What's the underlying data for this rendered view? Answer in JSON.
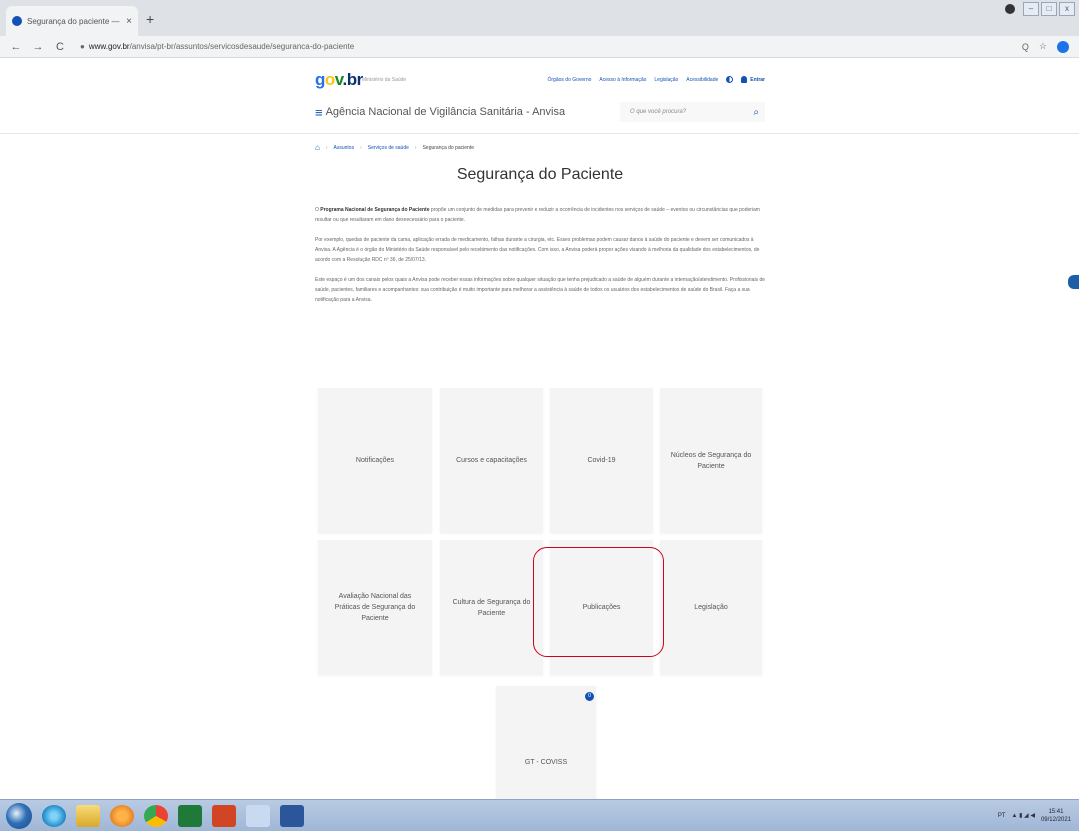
{
  "browser": {
    "tab_title": "Segurança do paciente — Portal",
    "tab_close": "×",
    "new_tab": "+",
    "url_domain": "www.gov.br",
    "url_path": "/anvisa/pt-br/assuntos/servicosdesaude/seguranca-do-paciente",
    "back": "←",
    "forward": "→",
    "reload": "C",
    "zoom": "Q",
    "star": "☆"
  },
  "header": {
    "logo": {
      "g": "g",
      "o": "o",
      "v": "v",
      "br": ".br"
    },
    "logo_sub": "Ministério da Saúde",
    "top_links": [
      "Órgãos do Governo",
      "Acesso à Informação",
      "Legislação",
      "Acessibilidade"
    ],
    "login_label": "Entrar",
    "site_name": "Agência Nacional de Vigilância Sanitária - Anvisa",
    "search_placeholder": "O que você procura?"
  },
  "breadcrumb": [
    "Assuntos",
    "Serviços de saúde",
    "Segurança do paciente"
  ],
  "page": {
    "title": "Segurança do Paciente",
    "p1_bold": "Programa Nacional de Segurança do Paciente",
    "p1_pre": "O ",
    "p1_rest": " propõe um conjunto de medidas para prevenir e reduzir a ocorrência de incidentes nos serviços de saúde – eventos ou circunstâncias que poderiam resultar ou que resultaram em dano desnecessário para o paciente.",
    "p2": "Por exemplo, quedas de paciente da cama, aplicação errada de medicamento, falhas durante a cirurgia, etc. Esses problemas podem causar danos à saúde do paciente e devem ser comunicados à Anvisa. A Agência é o órgão do Ministério da Saúde responsável pelo recebimento das notificações. Com isso, a Anvisa poderá propor ações visando à melhoria da qualidade dos estabelecimentos, de acordo com a Resolução RDC nº 36, de 25/07/13.",
    "p3": "Este espaço é um dos canais pelos quais a Anvisa pode receber essas informações sobre qualquer situação que tenha prejudicado a saúde de alguém durante a internação/atendimento. Profissionais de saúde, pacientes, familiares e acompanhantes: sua contribuição é muito importante para melhorar a assistência à saúde de todos os usuários dos estabelecimentos de saúde do Brasil. Faça a sua notificação para a Anvisa."
  },
  "cards": [
    "Notificações",
    "Cursos e capacitações",
    "Covid-19",
    "Núcleos de Segurança do Paciente",
    "Avaliação Nacional das Práticas de Segurança do Paciente",
    "Cultura de Segurança do Paciente",
    "Publicações",
    "Legislação",
    "GT - COVISS"
  ],
  "badge": "0",
  "tray": {
    "lang": "PT",
    "time": "15:41",
    "date": "09/12/2021"
  },
  "colors": {
    "accent": "#1351b4",
    "highlight": "#d0021b"
  }
}
